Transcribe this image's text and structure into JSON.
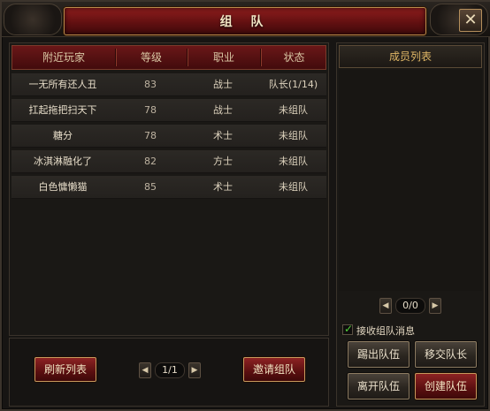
{
  "window": {
    "title": "组 队"
  },
  "nearby_table": {
    "columns": [
      "附近玩家",
      "等级",
      "职业",
      "状态"
    ],
    "rows": [
      {
        "name": "一无所有还人丑",
        "level": "83",
        "job": "战士",
        "status": "队长(1/14)"
      },
      {
        "name": "扛起拖把扫天下",
        "level": "78",
        "job": "战士",
        "status": "未组队"
      },
      {
        "name": "糖分",
        "level": "78",
        "job": "术士",
        "status": "未组队"
      },
      {
        "name": "冰淇淋融化了",
        "level": "82",
        "job": "方士",
        "status": "未组队"
      },
      {
        "name": "白色慵懒猫",
        "level": "85",
        "job": "术士",
        "status": "未组队"
      }
    ]
  },
  "left_bottom": {
    "refresh_label": "刷新列表",
    "invite_label": "邀请组队",
    "page": "1/1"
  },
  "members": {
    "title": "成员列表",
    "page": "0/0"
  },
  "options": {
    "receive_invites_label": "接收组队消息",
    "receive_invites_checked": true
  },
  "team_actions": {
    "kick_label": "踢出队伍",
    "transfer_label": "移交队长",
    "leave_label": "离开队伍",
    "create_label": "创建队伍"
  },
  "icons": {
    "close": "close-icon",
    "prev": "chevron-left-icon",
    "next": "chevron-right-icon",
    "check": "checkmark-icon"
  },
  "colors": {
    "accent_red": "#7a1516",
    "gold_text": "#e0b766",
    "check_green": "#53d23c"
  }
}
